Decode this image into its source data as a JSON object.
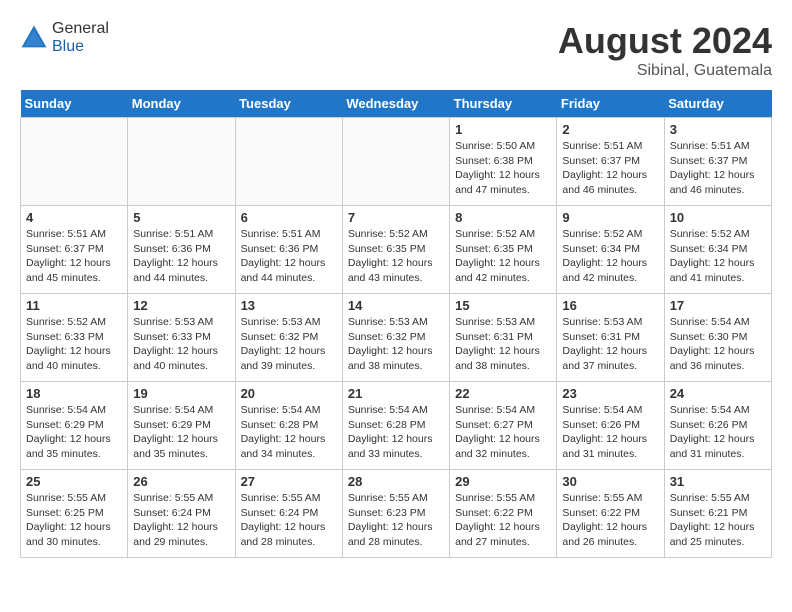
{
  "header": {
    "logo_general": "General",
    "logo_blue": "Blue",
    "month_year": "August 2024",
    "location": "Sibinal, Guatemala"
  },
  "weekdays": [
    "Sunday",
    "Monday",
    "Tuesday",
    "Wednesday",
    "Thursday",
    "Friday",
    "Saturday"
  ],
  "weeks": [
    [
      {
        "day": "",
        "info": ""
      },
      {
        "day": "",
        "info": ""
      },
      {
        "day": "",
        "info": ""
      },
      {
        "day": "",
        "info": ""
      },
      {
        "day": "1",
        "info": "Sunrise: 5:50 AM\nSunset: 6:38 PM\nDaylight: 12 hours\nand 47 minutes."
      },
      {
        "day": "2",
        "info": "Sunrise: 5:51 AM\nSunset: 6:37 PM\nDaylight: 12 hours\nand 46 minutes."
      },
      {
        "day": "3",
        "info": "Sunrise: 5:51 AM\nSunset: 6:37 PM\nDaylight: 12 hours\nand 46 minutes."
      }
    ],
    [
      {
        "day": "4",
        "info": "Sunrise: 5:51 AM\nSunset: 6:37 PM\nDaylight: 12 hours\nand 45 minutes."
      },
      {
        "day": "5",
        "info": "Sunrise: 5:51 AM\nSunset: 6:36 PM\nDaylight: 12 hours\nand 44 minutes."
      },
      {
        "day": "6",
        "info": "Sunrise: 5:51 AM\nSunset: 6:36 PM\nDaylight: 12 hours\nand 44 minutes."
      },
      {
        "day": "7",
        "info": "Sunrise: 5:52 AM\nSunset: 6:35 PM\nDaylight: 12 hours\nand 43 minutes."
      },
      {
        "day": "8",
        "info": "Sunrise: 5:52 AM\nSunset: 6:35 PM\nDaylight: 12 hours\nand 42 minutes."
      },
      {
        "day": "9",
        "info": "Sunrise: 5:52 AM\nSunset: 6:34 PM\nDaylight: 12 hours\nand 42 minutes."
      },
      {
        "day": "10",
        "info": "Sunrise: 5:52 AM\nSunset: 6:34 PM\nDaylight: 12 hours\nand 41 minutes."
      }
    ],
    [
      {
        "day": "11",
        "info": "Sunrise: 5:52 AM\nSunset: 6:33 PM\nDaylight: 12 hours\nand 40 minutes."
      },
      {
        "day": "12",
        "info": "Sunrise: 5:53 AM\nSunset: 6:33 PM\nDaylight: 12 hours\nand 40 minutes."
      },
      {
        "day": "13",
        "info": "Sunrise: 5:53 AM\nSunset: 6:32 PM\nDaylight: 12 hours\nand 39 minutes."
      },
      {
        "day": "14",
        "info": "Sunrise: 5:53 AM\nSunset: 6:32 PM\nDaylight: 12 hours\nand 38 minutes."
      },
      {
        "day": "15",
        "info": "Sunrise: 5:53 AM\nSunset: 6:31 PM\nDaylight: 12 hours\nand 38 minutes."
      },
      {
        "day": "16",
        "info": "Sunrise: 5:53 AM\nSunset: 6:31 PM\nDaylight: 12 hours\nand 37 minutes."
      },
      {
        "day": "17",
        "info": "Sunrise: 5:54 AM\nSunset: 6:30 PM\nDaylight: 12 hours\nand 36 minutes."
      }
    ],
    [
      {
        "day": "18",
        "info": "Sunrise: 5:54 AM\nSunset: 6:29 PM\nDaylight: 12 hours\nand 35 minutes."
      },
      {
        "day": "19",
        "info": "Sunrise: 5:54 AM\nSunset: 6:29 PM\nDaylight: 12 hours\nand 35 minutes."
      },
      {
        "day": "20",
        "info": "Sunrise: 5:54 AM\nSunset: 6:28 PM\nDaylight: 12 hours\nand 34 minutes."
      },
      {
        "day": "21",
        "info": "Sunrise: 5:54 AM\nSunset: 6:28 PM\nDaylight: 12 hours\nand 33 minutes."
      },
      {
        "day": "22",
        "info": "Sunrise: 5:54 AM\nSunset: 6:27 PM\nDaylight: 12 hours\nand 32 minutes."
      },
      {
        "day": "23",
        "info": "Sunrise: 5:54 AM\nSunset: 6:26 PM\nDaylight: 12 hours\nand 31 minutes."
      },
      {
        "day": "24",
        "info": "Sunrise: 5:54 AM\nSunset: 6:26 PM\nDaylight: 12 hours\nand 31 minutes."
      }
    ],
    [
      {
        "day": "25",
        "info": "Sunrise: 5:55 AM\nSunset: 6:25 PM\nDaylight: 12 hours\nand 30 minutes."
      },
      {
        "day": "26",
        "info": "Sunrise: 5:55 AM\nSunset: 6:24 PM\nDaylight: 12 hours\nand 29 minutes."
      },
      {
        "day": "27",
        "info": "Sunrise: 5:55 AM\nSunset: 6:24 PM\nDaylight: 12 hours\nand 28 minutes."
      },
      {
        "day": "28",
        "info": "Sunrise: 5:55 AM\nSunset: 6:23 PM\nDaylight: 12 hours\nand 28 minutes."
      },
      {
        "day": "29",
        "info": "Sunrise: 5:55 AM\nSunset: 6:22 PM\nDaylight: 12 hours\nand 27 minutes."
      },
      {
        "day": "30",
        "info": "Sunrise: 5:55 AM\nSunset: 6:22 PM\nDaylight: 12 hours\nand 26 minutes."
      },
      {
        "day": "31",
        "info": "Sunrise: 5:55 AM\nSunset: 6:21 PM\nDaylight: 12 hours\nand 25 minutes."
      }
    ]
  ]
}
